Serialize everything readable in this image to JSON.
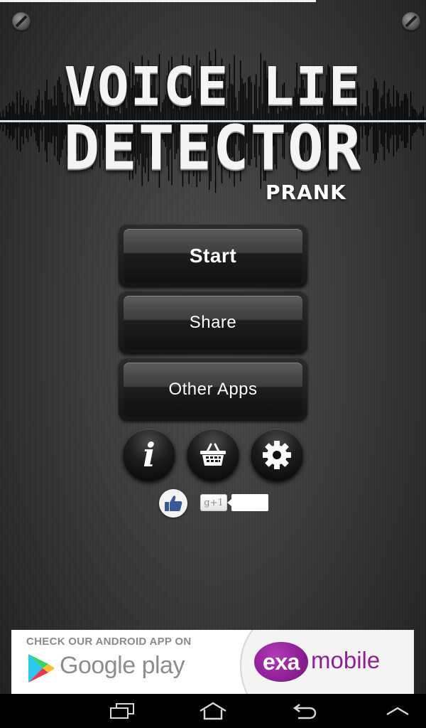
{
  "logo": {
    "line1": "VOICE LIE",
    "line2": "DETECTOR",
    "subtitle": "PRANK"
  },
  "menu": {
    "start_label": "Start",
    "share_label": "Share",
    "other_apps_label": "Other Apps"
  },
  "icon_buttons": [
    {
      "name": "info-icon",
      "glyph": "i"
    },
    {
      "name": "shopping-basket-icon"
    },
    {
      "name": "gear-icon"
    }
  ],
  "social": {
    "like_icon": "thumbs-up-icon",
    "gplus_label": "g+1",
    "gplus_count": ""
  },
  "ad": {
    "headline": "CHECK OUR ANDROID APP ON",
    "store_text": "Google play",
    "brand_pill": "exa",
    "brand_text": "mobile",
    "brand_color": "#8f1f96"
  },
  "system_nav": [
    "recent-apps-icon",
    "home-icon",
    "back-icon",
    "menu-icon"
  ],
  "colors": {
    "accent_wave": "#2fb6ff",
    "button_text": "#ffffff"
  }
}
